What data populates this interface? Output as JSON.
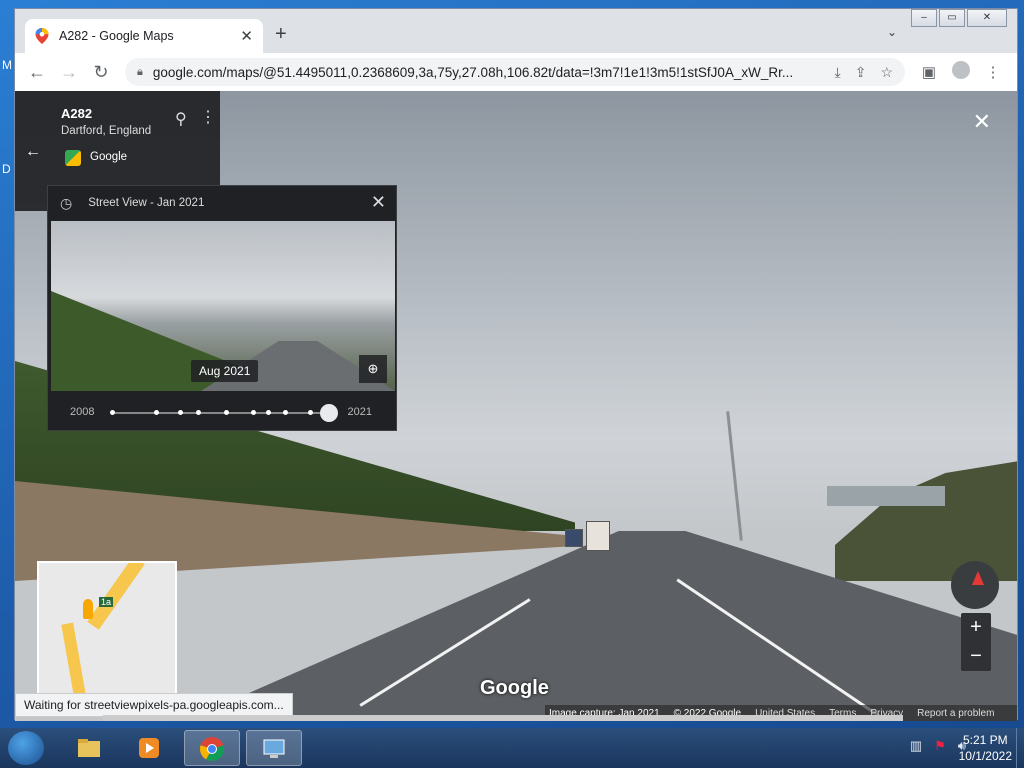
{
  "desktop": {
    "edge_letter_1": "M",
    "edge_letter_2": "D"
  },
  "browser": {
    "tab_title": "A282 - Google Maps",
    "tab_close": "✕",
    "new_tab": "+",
    "tab_search": "⌄",
    "url": "google.com/maps/@51.4495011,0.2368609,3a,75y,27.08h,106.82t/data=!3m7!1e1!3m5!1stSfJ0A_xW_Rr...",
    "win_minimize": "–",
    "win_maximize": "▭",
    "win_close": "✕"
  },
  "streetview": {
    "place_title": "A282",
    "place_subtitle": "Dartford, England",
    "source_label": "Google",
    "back_icon": "←",
    "close_icon": "✕",
    "timemachine": {
      "header": "Street View - Jan 2021",
      "preview_date": "Aug 2021",
      "year_start": "2008",
      "year_end": "2021",
      "close": "✕"
    },
    "brand_logo": "Google",
    "footer": {
      "capture": "Image capture: Jan 2021",
      "copyright": "© 2022 Google",
      "region": "United States",
      "terms": "Terms",
      "privacy": "Privacy",
      "report": "Report a problem"
    },
    "minimap_label": "1a",
    "zoom_in": "+",
    "zoom_out": "−"
  },
  "status_bar": "Waiting for streetviewpixels-pa.googleapis.com...",
  "taskbar": {
    "time": "5:21 PM",
    "date": "10/1/2022"
  }
}
